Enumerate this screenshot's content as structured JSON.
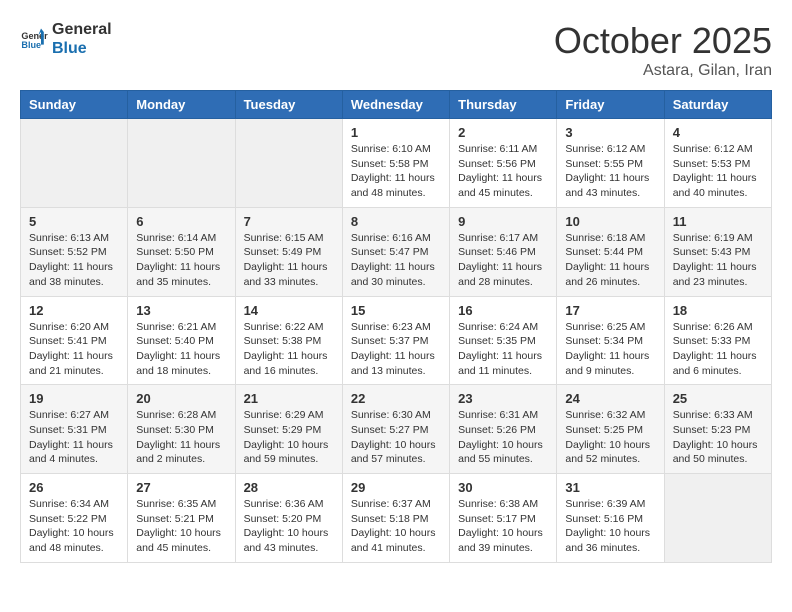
{
  "header": {
    "logo_line1": "General",
    "logo_line2": "Blue",
    "month": "October 2025",
    "location": "Astara, Gilan, Iran"
  },
  "days_of_week": [
    "Sunday",
    "Monday",
    "Tuesday",
    "Wednesday",
    "Thursday",
    "Friday",
    "Saturday"
  ],
  "weeks": [
    [
      {
        "num": "",
        "info": ""
      },
      {
        "num": "",
        "info": ""
      },
      {
        "num": "",
        "info": ""
      },
      {
        "num": "1",
        "info": "Sunrise: 6:10 AM\nSunset: 5:58 PM\nDaylight: 11 hours\nand 48 minutes."
      },
      {
        "num": "2",
        "info": "Sunrise: 6:11 AM\nSunset: 5:56 PM\nDaylight: 11 hours\nand 45 minutes."
      },
      {
        "num": "3",
        "info": "Sunrise: 6:12 AM\nSunset: 5:55 PM\nDaylight: 11 hours\nand 43 minutes."
      },
      {
        "num": "4",
        "info": "Sunrise: 6:12 AM\nSunset: 5:53 PM\nDaylight: 11 hours\nand 40 minutes."
      }
    ],
    [
      {
        "num": "5",
        "info": "Sunrise: 6:13 AM\nSunset: 5:52 PM\nDaylight: 11 hours\nand 38 minutes."
      },
      {
        "num": "6",
        "info": "Sunrise: 6:14 AM\nSunset: 5:50 PM\nDaylight: 11 hours\nand 35 minutes."
      },
      {
        "num": "7",
        "info": "Sunrise: 6:15 AM\nSunset: 5:49 PM\nDaylight: 11 hours\nand 33 minutes."
      },
      {
        "num": "8",
        "info": "Sunrise: 6:16 AM\nSunset: 5:47 PM\nDaylight: 11 hours\nand 30 minutes."
      },
      {
        "num": "9",
        "info": "Sunrise: 6:17 AM\nSunset: 5:46 PM\nDaylight: 11 hours\nand 28 minutes."
      },
      {
        "num": "10",
        "info": "Sunrise: 6:18 AM\nSunset: 5:44 PM\nDaylight: 11 hours\nand 26 minutes."
      },
      {
        "num": "11",
        "info": "Sunrise: 6:19 AM\nSunset: 5:43 PM\nDaylight: 11 hours\nand 23 minutes."
      }
    ],
    [
      {
        "num": "12",
        "info": "Sunrise: 6:20 AM\nSunset: 5:41 PM\nDaylight: 11 hours\nand 21 minutes."
      },
      {
        "num": "13",
        "info": "Sunrise: 6:21 AM\nSunset: 5:40 PM\nDaylight: 11 hours\nand 18 minutes."
      },
      {
        "num": "14",
        "info": "Sunrise: 6:22 AM\nSunset: 5:38 PM\nDaylight: 11 hours\nand 16 minutes."
      },
      {
        "num": "15",
        "info": "Sunrise: 6:23 AM\nSunset: 5:37 PM\nDaylight: 11 hours\nand 13 minutes."
      },
      {
        "num": "16",
        "info": "Sunrise: 6:24 AM\nSunset: 5:35 PM\nDaylight: 11 hours\nand 11 minutes."
      },
      {
        "num": "17",
        "info": "Sunrise: 6:25 AM\nSunset: 5:34 PM\nDaylight: 11 hours\nand 9 minutes."
      },
      {
        "num": "18",
        "info": "Sunrise: 6:26 AM\nSunset: 5:33 PM\nDaylight: 11 hours\nand 6 minutes."
      }
    ],
    [
      {
        "num": "19",
        "info": "Sunrise: 6:27 AM\nSunset: 5:31 PM\nDaylight: 11 hours\nand 4 minutes."
      },
      {
        "num": "20",
        "info": "Sunrise: 6:28 AM\nSunset: 5:30 PM\nDaylight: 11 hours\nand 2 minutes."
      },
      {
        "num": "21",
        "info": "Sunrise: 6:29 AM\nSunset: 5:29 PM\nDaylight: 10 hours\nand 59 minutes."
      },
      {
        "num": "22",
        "info": "Sunrise: 6:30 AM\nSunset: 5:27 PM\nDaylight: 10 hours\nand 57 minutes."
      },
      {
        "num": "23",
        "info": "Sunrise: 6:31 AM\nSunset: 5:26 PM\nDaylight: 10 hours\nand 55 minutes."
      },
      {
        "num": "24",
        "info": "Sunrise: 6:32 AM\nSunset: 5:25 PM\nDaylight: 10 hours\nand 52 minutes."
      },
      {
        "num": "25",
        "info": "Sunrise: 6:33 AM\nSunset: 5:23 PM\nDaylight: 10 hours\nand 50 minutes."
      }
    ],
    [
      {
        "num": "26",
        "info": "Sunrise: 6:34 AM\nSunset: 5:22 PM\nDaylight: 10 hours\nand 48 minutes."
      },
      {
        "num": "27",
        "info": "Sunrise: 6:35 AM\nSunset: 5:21 PM\nDaylight: 10 hours\nand 45 minutes."
      },
      {
        "num": "28",
        "info": "Sunrise: 6:36 AM\nSunset: 5:20 PM\nDaylight: 10 hours\nand 43 minutes."
      },
      {
        "num": "29",
        "info": "Sunrise: 6:37 AM\nSunset: 5:18 PM\nDaylight: 10 hours\nand 41 minutes."
      },
      {
        "num": "30",
        "info": "Sunrise: 6:38 AM\nSunset: 5:17 PM\nDaylight: 10 hours\nand 39 minutes."
      },
      {
        "num": "31",
        "info": "Sunrise: 6:39 AM\nSunset: 5:16 PM\nDaylight: 10 hours\nand 36 minutes."
      },
      {
        "num": "",
        "info": ""
      }
    ]
  ]
}
